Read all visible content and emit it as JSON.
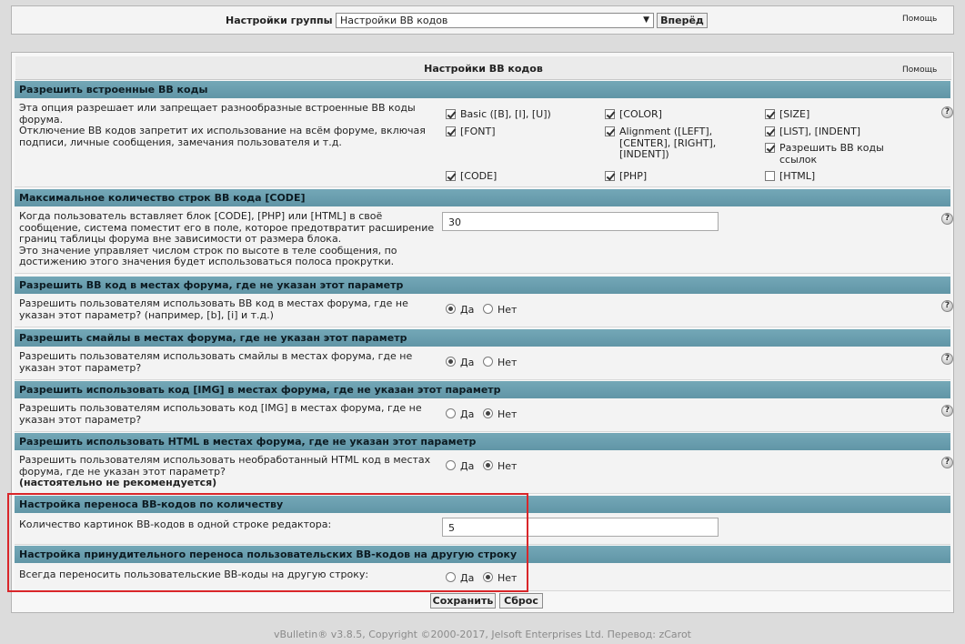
{
  "topbar": {
    "group_label": "Настройки группы",
    "group_select": "Настройки BB кодов",
    "go_button": "Вперёд",
    "help": "Помощь"
  },
  "panel": {
    "title": "Настройки BB кодов",
    "help": "Помощь",
    "help_glyph": "?"
  },
  "sections": [
    {
      "title": "Разрешить встроенные BB коды",
      "description": "Эта опция разрешает или запрещает разнообразные встроенные BB коды форума.\nОтключение BB кодов запретит их использование на всём форуме, включая подписи, личные сообщения, замечания пользователя и т.д.",
      "options": [
        {
          "label": "Basic ([B], [I], [U])",
          "checked": true
        },
        {
          "label": "[COLOR]",
          "checked": true
        },
        {
          "label": "[SIZE]",
          "checked": true
        },
        {
          "label": "[FONT]",
          "checked": true
        },
        {
          "label": "Alignment ([LEFT], [CENTER], [RIGHT], [INDENT])",
          "checked": true
        },
        {
          "label": "[LIST], [INDENT]",
          "checked": true
        },
        {
          "label": "Разрешить BB коды ссылок",
          "checked": true
        },
        {
          "label": "[CODE]",
          "checked": true
        },
        {
          "label": "[PHP]",
          "checked": true
        },
        {
          "label": "[HTML]",
          "checked": false
        }
      ]
    },
    {
      "title": "Максимальное количество строк BB кода [CODE]",
      "description": "Когда пользователь вставляет блок [CODE], [PHP] или [HTML] в своё сообщение, система поместит его в поле, которое предотвратит расширение границ таблицы форума вне зависимости от размера блока.\nЭто значение управляет числом строк по высоте в теле сообщения, по достижению этого значения будет использоваться полоса прокрутки.",
      "value": "30"
    },
    {
      "title": "Разрешить BB код в местах форума, где не указан этот параметр",
      "description": "Разрешить пользователям использовать BB код в местах форума, где не указан этот параметр? (например, [b], [i] и т.д.)",
      "yes": "Да",
      "no": "Нет",
      "selected": "yes"
    },
    {
      "title": "Разрешить смайлы в местах форума, где не указан этот параметр",
      "description": "Разрешить пользователям использовать смайлы в местах форума, где не указан этот параметр?",
      "yes": "Да",
      "no": "Нет",
      "selected": "yes"
    },
    {
      "title": "Разрешить использовать код [IMG] в местах форума, где не указан этот параметр",
      "description": "Разрешить пользователям использовать код [IMG] в местах форума, где не указан этот параметр?",
      "yes": "Да",
      "no": "Нет",
      "selected": "no"
    },
    {
      "title": "Разрешить использовать HTML в местах форума, где не указан этот параметр",
      "description": "Разрешить пользователям использовать необработанный HTML код в местах форума, где не указан этот параметр?",
      "description_bold": "(настоятельно не рекомендуется)",
      "yes": "Да",
      "no": "Нет",
      "selected": "no"
    },
    {
      "title": "Настройка переноса BB-кодов по количеству",
      "description": "Количество картинок BB-кодов в одной строке редактора:",
      "value": "5"
    },
    {
      "title": "Настройка принудительного переноса пользовательских BB-кодов на другую строку",
      "description": "Всегда переносить пользовательские BB-коды на другую строку:",
      "yes": "Да",
      "no": "Нет",
      "selected": "no"
    }
  ],
  "buttons": {
    "save": "Сохранить",
    "reset": "Сброс"
  },
  "footer": "vBulletin® v3.8.5, Copyright ©2000-2017, Jelsoft Enterprises Ltd. Перевод: zCarot",
  "colors": {
    "section_header": "#4a8598",
    "highlight": "#d9262a"
  }
}
